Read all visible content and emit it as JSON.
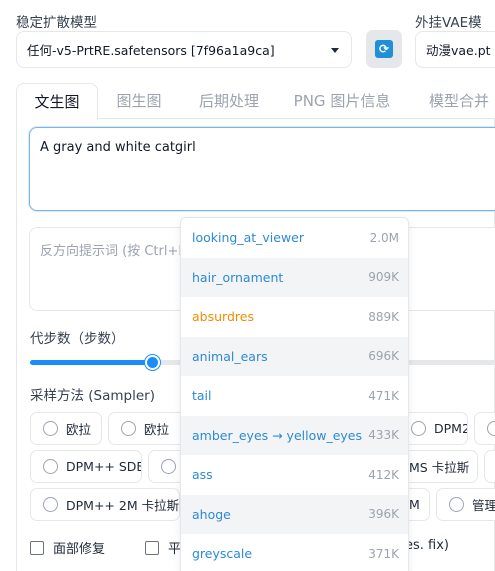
{
  "model_section": {
    "label": "稳定扩散模型",
    "value": "任何-v5-PrtRE.safetensors [7f96a1a9ca]"
  },
  "vae_section": {
    "label": "外挂VAE模型",
    "value": "动漫vae.pt"
  },
  "refresh_icon": "refresh-icon",
  "tabs": [
    "文生图",
    "图生图",
    "后期处理",
    "PNG 图片信息",
    "模型合并"
  ],
  "prompt": {
    "value": "A gray and white catgirl",
    "negative_placeholder": "反方向提示词 (按 Ctrl+E"
  },
  "steps": {
    "label": "代步数（步数）",
    "fill_fraction": 0.26
  },
  "sampler": {
    "label": "采样方法 (Sampler)",
    "options_row1": [
      "欧拉",
      "欧拉",
      "DPM2",
      ""
    ],
    "options_row2": [
      "DPM++ SDE",
      "",
      "MS 卡拉斯",
      ""
    ],
    "options_row3": [
      "DPM++ 2M 卡拉斯",
      "M",
      "管理"
    ]
  },
  "checkboxes": {
    "face_restore": "面部修复",
    "tiling_partial": "平",
    "hires_partial": "es. fix)"
  },
  "autocomplete": [
    {
      "tag": "looking_at_viewer",
      "count": "2.0M",
      "nsfw": false
    },
    {
      "tag": "hair_ornament",
      "count": "909K",
      "nsfw": false
    },
    {
      "tag": "absurdres",
      "count": "889K",
      "nsfw": true
    },
    {
      "tag": "animal_ears",
      "count": "696K",
      "nsfw": false
    },
    {
      "tag": "tail",
      "count": "471K",
      "nsfw": false
    },
    {
      "tag": "amber_eyes → yellow_eyes",
      "count": "433K",
      "nsfw": false
    },
    {
      "tag": "ass",
      "count": "412K",
      "nsfw": false
    },
    {
      "tag": "ahoge",
      "count": "396K",
      "nsfw": false
    },
    {
      "tag": "greyscale",
      "count": "371K",
      "nsfw": false
    }
  ],
  "colors": {
    "accent": "#1d8cf8",
    "tag_link": "#2b8ad6",
    "tag_nsfw": "#f08c00"
  }
}
